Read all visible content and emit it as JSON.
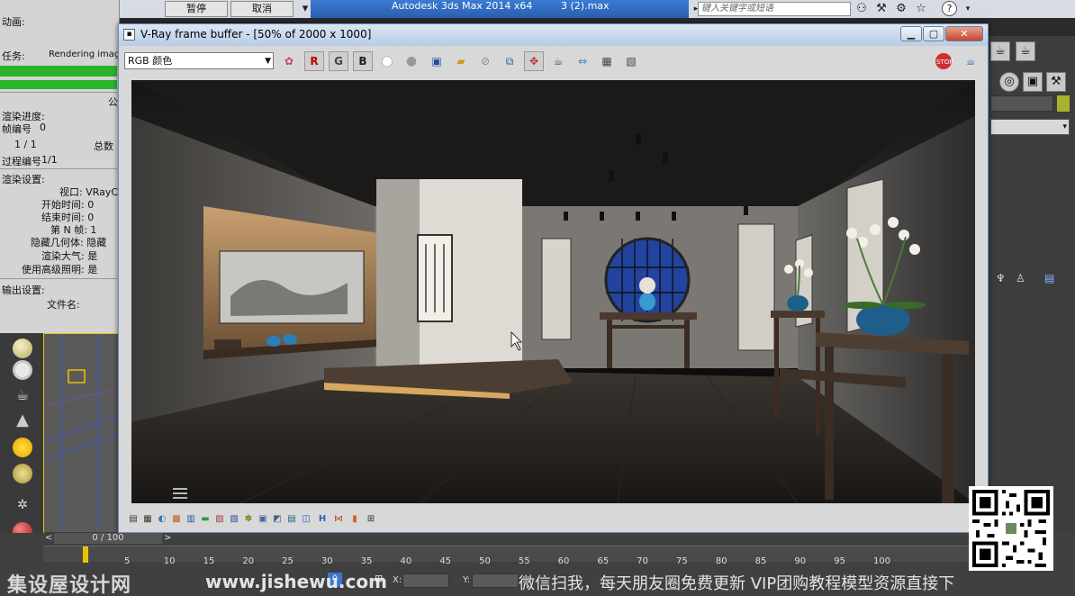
{
  "topbar": {
    "btn_pause": "暂停",
    "btn_cancel": "取消",
    "app_title": "Autodesk 3ds Max  2014 x64",
    "file_name": "3 (2).max",
    "search_placeholder": "键入关键字或短语"
  },
  "leftpanel": {
    "label_animation": "动画:",
    "label_task": "任务:",
    "task_value": "Rendering image",
    "label_common": "公",
    "label_render_progress": "渲染进度:",
    "label_frame_no": "帧编号",
    "frame_no_value": "0",
    "frame_count": "1 / 1",
    "label_total": "总数",
    "label_pass_no": "过程编号",
    "pass_no_value": "1/1",
    "label_render_settings": "渲染设置:",
    "setting_viewport": "视口: VRayC",
    "setting_start": "开始时间: 0",
    "setting_end": "结束时间: 0",
    "setting_nth": "第 N 帧: 1",
    "setting_hidden": "隐藏几何体: 隐藏",
    "setting_atmos": "渲染大气: 是",
    "setting_adv": "使用高级照明: 是",
    "label_output": "输出设置:",
    "label_filename": "文件名:"
  },
  "vfb": {
    "title": "V-Ray frame buffer - [50% of 2000 x 1000]",
    "channel": "RGB 颜色",
    "btn_r": "R",
    "btn_g": "G",
    "btn_b": "B"
  },
  "timeline": {
    "frame_counter": "0 / 100",
    "ticks": [
      "5",
      "10",
      "15",
      "20",
      "25",
      "30",
      "35",
      "40",
      "45",
      "50",
      "55",
      "60",
      "65",
      "70",
      "75",
      "80",
      "85",
      "90",
      "95",
      "100"
    ],
    "x_label": "X:",
    "y_label": "Y:"
  },
  "watermark": {
    "logo_text": "集设屋设计网",
    "url": "www.jishewu.com",
    "promo": "微信扫我，每天朋友圈免费更新 VIP团购教程模型资源直接下"
  },
  "colors": {
    "progress": "#2ab42a",
    "titlebar": "#b8cce6",
    "accent_red": "#c00000"
  }
}
